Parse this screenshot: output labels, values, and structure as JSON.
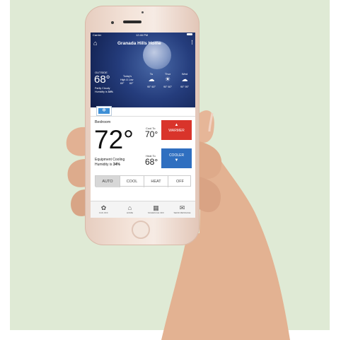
{
  "status_bar": {
    "carrier": "Carrier",
    "time": "12:46 PM"
  },
  "header": {
    "title": "Granada Hills Home"
  },
  "outside": {
    "label": "OUTSIDE",
    "temp": "68°",
    "condition": "Partly Cloudy",
    "humidity_label": "Humidity is ",
    "humidity": "34%"
  },
  "today": {
    "line1": "Today's",
    "line2": "High & Low",
    "high": "69°",
    "low": "60°"
  },
  "forecast": [
    {
      "day": "Tu",
      "icon": "rain-cloud-icon",
      "temps": "90° 60°"
    },
    {
      "day": "Thur",
      "icon": "sun-icon",
      "temps": "90° 60°"
    },
    {
      "day": "Wed",
      "icon": "rain-cloud-icon",
      "temps": "90° 95°"
    }
  ],
  "device": {
    "icon": "thermostat-snowflake-icon"
  },
  "room": {
    "name": "Bedroom",
    "temp": "72°",
    "status": "Equipment Cooling",
    "humidity_label": "Humidity is ",
    "humidity": "34%"
  },
  "cool_to": {
    "label": "Cool To",
    "value": "70°",
    "button": "WARMER"
  },
  "heat_to": {
    "label": "Heat To",
    "value": "68°",
    "button": "COOLER"
  },
  "modes": {
    "selected": "AUTO",
    "options": [
      "AUTO",
      "COOL",
      "HEAT",
      "OFF"
    ]
  },
  "tabs": [
    {
      "label": "FAN OFF",
      "icon": "fan-icon"
    },
    {
      "label": "HOME",
      "icon": "home-icon"
    },
    {
      "label": "SCHEDULE OFF",
      "icon": "schedule-icon"
    },
    {
      "label": "SEND MESSAGE",
      "icon": "envelope-icon"
    }
  ],
  "colors": {
    "warmer": "#d9342b",
    "cooler": "#2f6fc0",
    "background": "#dfead5"
  }
}
